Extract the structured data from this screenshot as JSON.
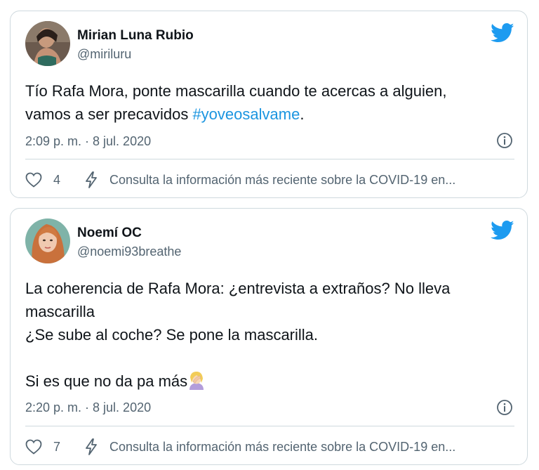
{
  "tweets": [
    {
      "author_name": "Mirian Luna Rubio",
      "author_handle": "@miriluru",
      "text_main": "Tío Rafa Mora, ponte mascarilla cuando te acercas a alguien,\nvamos a ser precavidos ",
      "hashtag": "#yoveosalvame",
      "text_end": ".",
      "timestamp": "2:09 p. m. · 8 jul. 2020",
      "likes": "4",
      "covid_notice": "Consulta la información más reciente sobre la COVID-19 en..."
    },
    {
      "author_name": "Noemí OC",
      "author_handle": "@noemi93breathe",
      "text_main": "La coherencia de Rafa Mora: ¿entrevista a extraños? No lleva\nmascarilla\n¿Se sube al coche? Se pone la mascarilla.\n\nSi es que no da pa más",
      "timestamp": "2:20 p. m. · 8 jul. 2020",
      "likes": "7",
      "covid_notice": "Consulta la información más reciente sobre la COVID-19 en..."
    }
  ],
  "icons": {
    "brand": "twitter-bird-icon",
    "info": "info-circle-icon",
    "like": "heart-icon",
    "covid": "lightning-bolt-icon",
    "emoji": "woman-facepalming-emoji"
  },
  "colors": {
    "twitter_blue": "#1d9bf0",
    "hashtag": "#1b95e0",
    "secondary_text": "#536471",
    "border": "#cfd9de"
  }
}
